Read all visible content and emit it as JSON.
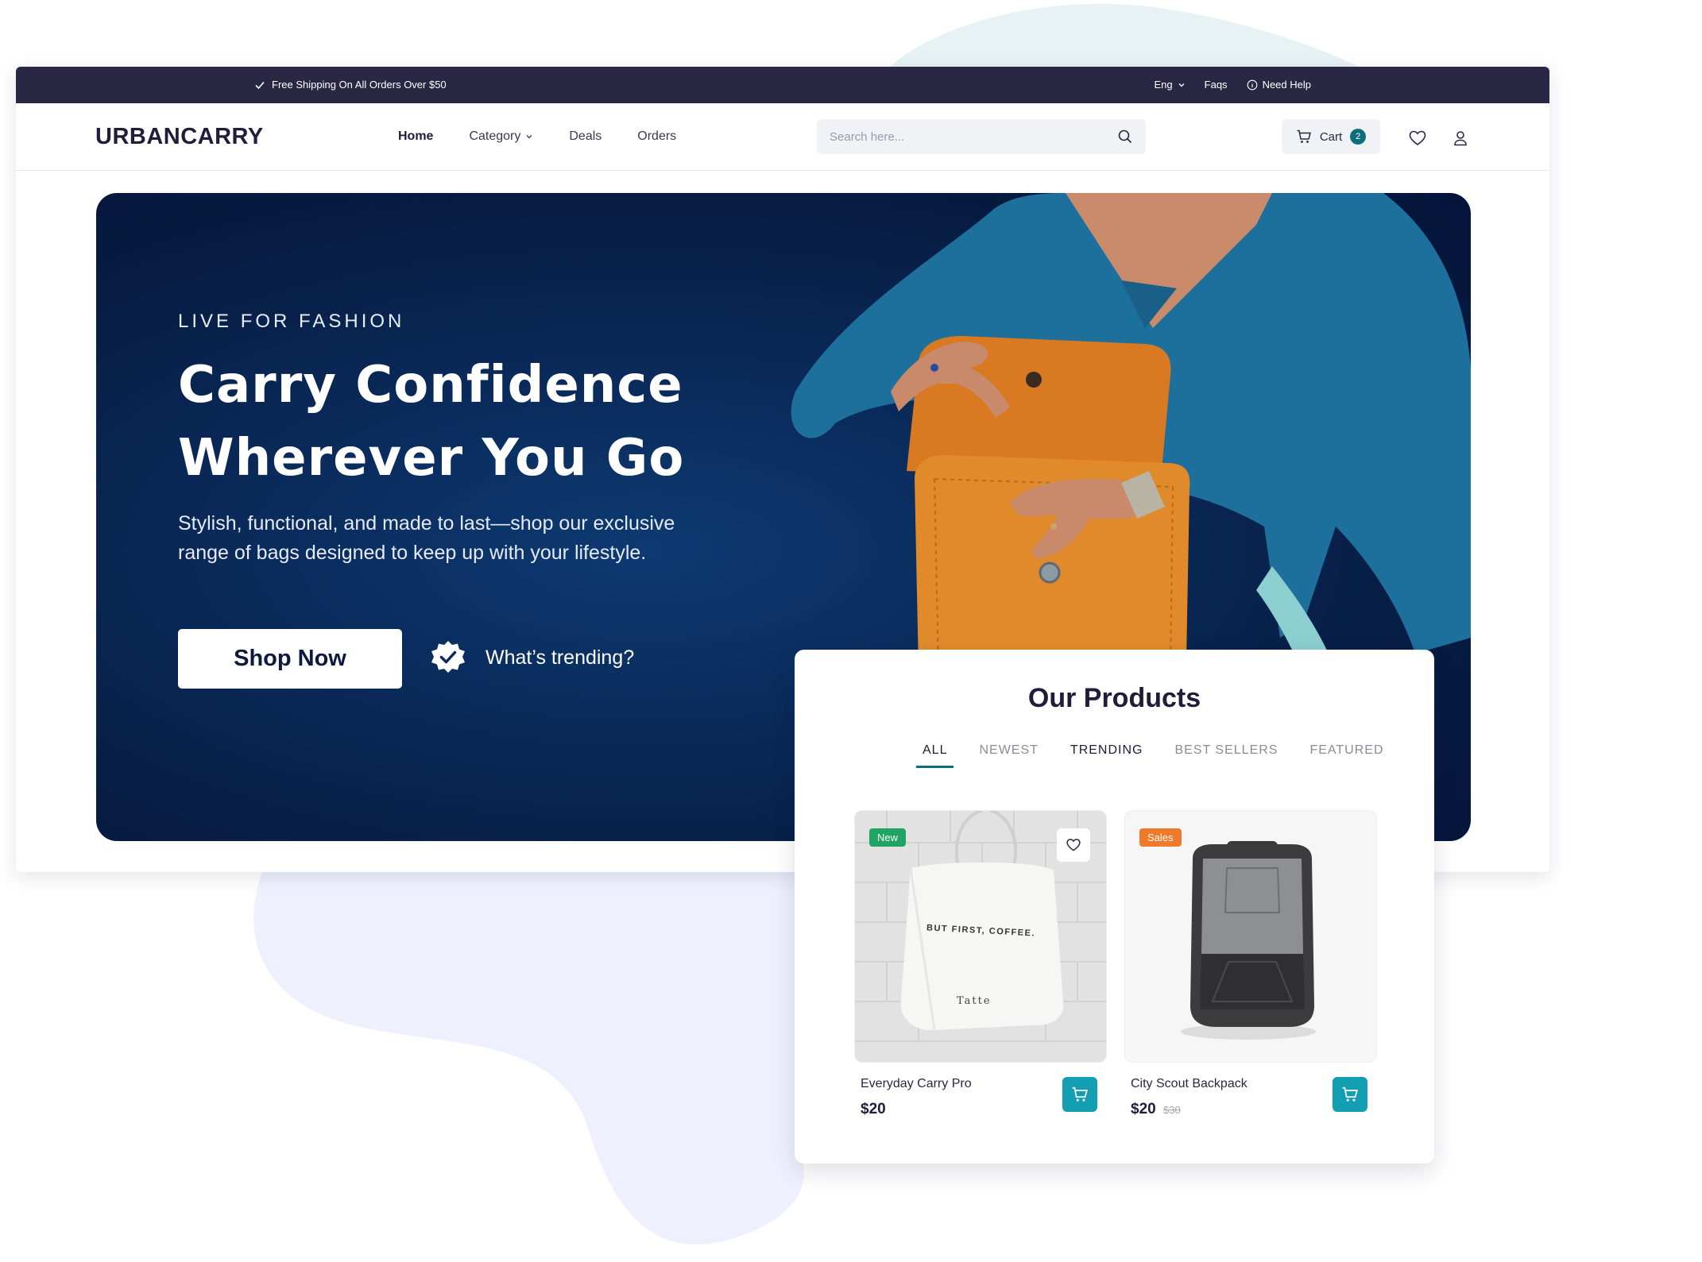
{
  "topbar": {
    "shipping": "Free Shipping On All Orders Over $50",
    "language": "Eng",
    "faqs": "Faqs",
    "help": "Need Help"
  },
  "header": {
    "logo": "URBANCARRY",
    "nav": [
      {
        "label": "Home"
      },
      {
        "label": "Category"
      },
      {
        "label": "Deals"
      },
      {
        "label": "Orders"
      }
    ],
    "search_placeholder": "Search here...",
    "cart_label": "Cart",
    "cart_count": "2"
  },
  "hero": {
    "eyebrow": "LIVE FOR FASHION",
    "headline_line1": "Carry Confidence",
    "headline_line2": "Wherever You Go",
    "subtext": "Stylish, functional, and made to last—shop our exclusive range of bags designed to keep up with your lifestyle.",
    "cta": "Shop Now",
    "trending": "What’s trending?"
  },
  "products": {
    "title": "Our Products",
    "tabs": [
      {
        "label": "ALL"
      },
      {
        "label": "NEWEST"
      },
      {
        "label": "TRENDING"
      },
      {
        "label": "BEST SELLERS"
      },
      {
        "label": "FEATURED"
      }
    ],
    "items": [
      {
        "name": "Everyday Carry Pro",
        "price": "$20",
        "badge": "New",
        "bag_text": "BUT FIRST, COFFEE.",
        "bag_script": "Tatte"
      },
      {
        "name": "City Scout Backpack",
        "price": "$20",
        "old_price": "$30",
        "badge": "Sales"
      }
    ]
  },
  "colors": {
    "topbar": "#2a2745",
    "accent_teal": "#0f6e7c",
    "cart_button": "#129fb2",
    "badge_new": "#1fa463",
    "badge_sales": "#f07a2c",
    "hero_bg": "#061a3f"
  }
}
